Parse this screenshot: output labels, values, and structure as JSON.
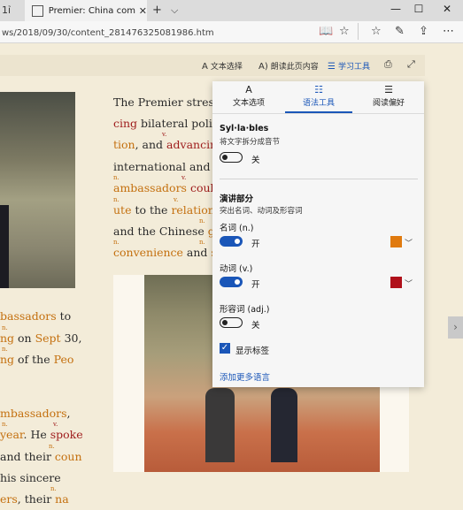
{
  "browser": {
    "prev_tab_label": "1ỉ",
    "tab_title": "Premier: China committ",
    "new_tab": "+",
    "tab_list": "⌵",
    "url": "ws/2018/09/30/content_281476325081986.htm"
  },
  "reader_toolbar": {
    "text_options": "文本选择",
    "read_aloud": "朗读此页内容",
    "learning_tools": "学习工具"
  },
  "panel": {
    "tabs": [
      "文本选项",
      "语法工具",
      "阅读偏好"
    ],
    "syllables": {
      "title": "Syl·la·bles",
      "subtitle": "将文字拆分成音节",
      "state": "关"
    },
    "parts_of_speech": {
      "title": "演讲部分",
      "subtitle": "突出名词、动词及形容词"
    },
    "nouns": {
      "label": "名词 (n.)",
      "state": "开",
      "color": "#e07a0e"
    },
    "verbs": {
      "label": "动词 (v.)",
      "state": "开",
      "color": "#b0101a"
    },
    "adjectives": {
      "label": "形容词 (adj.)",
      "state": "关"
    },
    "show_labels": "显示标签",
    "add_languages": "添加更多语言"
  },
  "article": {
    "right_col": [
      {
        "words": [
          {
            "t": "The Premier stresse",
            "c": "plain"
          }
        ]
      },
      {
        "words": [
          {
            "t": "cing",
            "c": "v"
          },
          {
            "t": " bilateral politic",
            "c": "plain"
          }
        ]
      },
      {
        "words": [
          {
            "t": "tion",
            "c": "n"
          },
          {
            "t": ", and ",
            "c": "plain"
          },
          {
            "t": "advancing",
            "c": "v"
          }
        ]
      },
      {
        "words": [
          {
            "t": "international and re",
            "c": "plain"
          }
        ]
      },
      {
        "words": [
          {
            "t": "ambassadors",
            "c": "n"
          },
          {
            "t": " ",
            "c": "plain"
          },
          {
            "t": "could",
            "c": "v"
          }
        ]
      },
      {
        "words": [
          {
            "t": "ute",
            "c": "n"
          },
          {
            "t": " to the ",
            "c": "plain"
          },
          {
            "t": "relationsh",
            "c": "n"
          }
        ]
      },
      {
        "words": [
          {
            "t": "and the Chinese ",
            "c": "plain"
          },
          {
            "t": "gov",
            "c": "n"
          }
        ]
      },
      {
        "words": [
          {
            "t": "convenience",
            "c": "n"
          },
          {
            "t": " and ",
            "c": "plain"
          },
          {
            "t": "su",
            "c": "n"
          }
        ]
      }
    ],
    "left_col": [
      {
        "words": [
          {
            "t": "bassadors",
            "c": "n"
          },
          {
            "t": " to",
            "c": "plain"
          }
        ]
      },
      {
        "words": [
          {
            "t": "ng",
            "c": "n"
          },
          {
            "t": " on ",
            "c": "plain"
          },
          {
            "t": "Sept",
            "c": "n"
          },
          {
            "t": " 30,",
            "c": "plain"
          }
        ]
      },
      {
        "words": [
          {
            "t": "ng",
            "c": "n"
          },
          {
            "t": " of the ",
            "c": "plain"
          },
          {
            "t": "Peo",
            "c": "n"
          }
        ]
      },
      {
        "words": [
          {
            "t": "mbassadors",
            "c": "n"
          },
          {
            "t": ",",
            "c": "plain"
          }
        ]
      },
      {
        "words": [
          {
            "t": "year",
            "c": "n"
          },
          {
            "t": ". He ",
            "c": "plain"
          },
          {
            "t": "spoke",
            "c": "v"
          }
        ]
      },
      {
        "words": [
          {
            "t": "and their ",
            "c": "plain"
          },
          {
            "t": "coun",
            "c": "n"
          }
        ]
      },
      {
        "words": [
          {
            "t": "his sincere",
            "c": "plain"
          }
        ]
      },
      {
        "words": [
          {
            "t": "ers",
            "c": "n"
          },
          {
            "t": ", their ",
            "c": "plain"
          },
          {
            "t": "na",
            "c": "n"
          }
        ]
      }
    ],
    "tags": [
      {
        "t": "v.",
        "row": "r1"
      },
      {
        "t": "n.",
        "row": "r2a"
      },
      {
        "t": "v.",
        "row": "r2b"
      },
      {
        "t": "n.",
        "row": "r4a"
      },
      {
        "t": "v.",
        "row": "r4b"
      },
      {
        "t": "n.",
        "row": "r5a"
      },
      {
        "t": "n.",
        "row": "r5b"
      },
      {
        "t": "n.",
        "row": "r6a"
      },
      {
        "t": "n.",
        "row": "r7a"
      },
      {
        "t": "n.",
        "row": "r7b"
      },
      {
        "t": "n.",
        "row": "l1"
      },
      {
        "t": "n.",
        "row": "l2"
      },
      {
        "t": "n.",
        "row": "l4a"
      },
      {
        "t": "n.",
        "row": "l4b"
      },
      {
        "t": "v.",
        "row": "l4c"
      },
      {
        "t": "n.",
        "row": "l5"
      },
      {
        "t": "n.",
        "row": "l7"
      }
    ]
  }
}
